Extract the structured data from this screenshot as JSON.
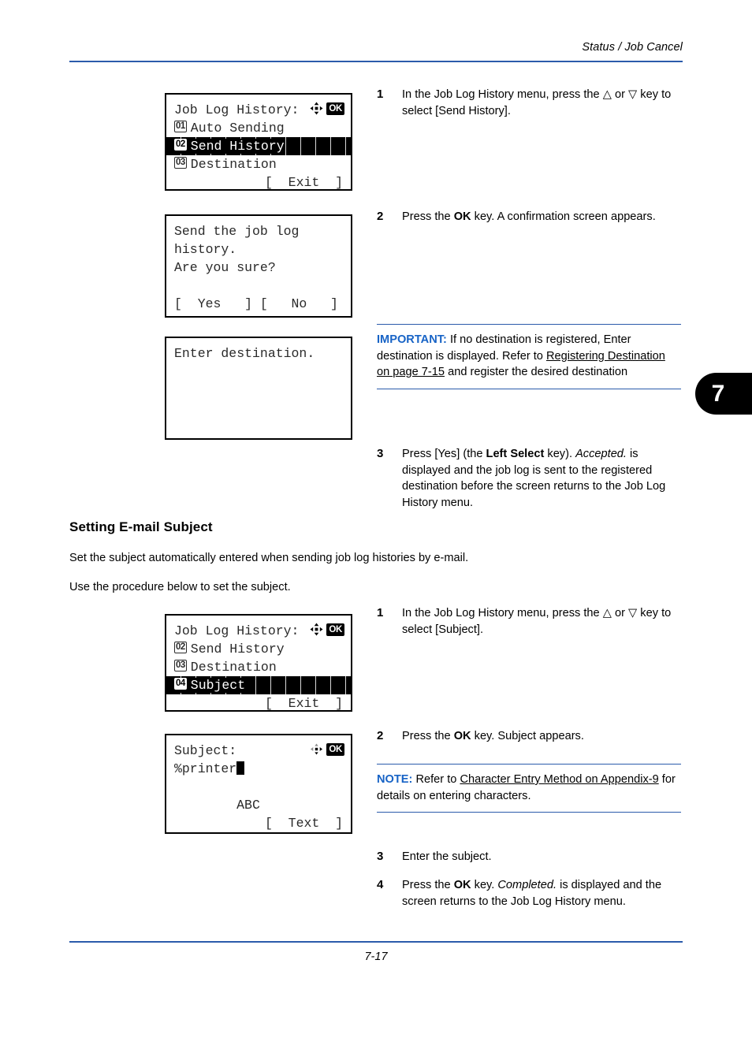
{
  "header": {
    "running_head": "Status / Job Cancel",
    "rule_color": "#2b5bab"
  },
  "chapter_tab": {
    "number": "7"
  },
  "footer": {
    "page_number": "7-17"
  },
  "lcd_panels": [
    {
      "name": "job-log-history-send-history",
      "title": "Job Log History:",
      "indicator_ok": "OK",
      "indicator_arrows": "four-way-arrow",
      "rows": [
        {
          "num": "01",
          "label": "Auto Sending",
          "selected": false
        },
        {
          "num": "02",
          "label": "Send History",
          "selected": true
        },
        {
          "num": "03",
          "label": "Destination",
          "selected": false
        }
      ],
      "softkey": "[  Exit  ]"
    },
    {
      "name": "confirm-send-job-log",
      "lines": [
        "Send the job log",
        "history.",
        "Are you sure?"
      ],
      "softkeys": "[  Yes   ] [   No   ]"
    },
    {
      "name": "enter-destination",
      "lines": [
        "Enter destination."
      ]
    },
    {
      "name": "job-log-history-subject",
      "title": "Job Log History:",
      "indicator_ok": "OK",
      "indicator_arrows": "four-way-arrow",
      "rows": [
        {
          "num": "02",
          "label": "Send History",
          "selected": false
        },
        {
          "num": "03",
          "label": "Destination",
          "selected": false
        },
        {
          "num": "04",
          "label": "Subject",
          "selected": true
        }
      ],
      "softkey": "[  Exit  ]"
    },
    {
      "name": "subject-entry",
      "title": "Subject:",
      "indicator_ok": "OK",
      "indicator_arrows": "left-right-arrow",
      "value": "%printer",
      "input_mode": "ABC",
      "softkey": "[  Text  ]"
    }
  ],
  "steps_send_history": [
    {
      "num": "1",
      "parts": [
        {
          "t": "In the Job Log History menu, press the "
        },
        {
          "t": "△",
          "style": "plain"
        },
        {
          "t": " or "
        },
        {
          "t": "▽",
          "style": "plain"
        },
        {
          "t": " key to select [Send History]."
        }
      ],
      "plain": "In the Job Log History menu, press the △ or ▽ key to select [Send History]."
    },
    {
      "num": "2",
      "plain": "Press the OK key. A confirmation screen appears."
    },
    {
      "num": "3",
      "plain": "Press [Yes] (the Left Select key). Accepted. is displayed and the job log is sent to the registered destination before the screen returns to the Job Log History menu."
    }
  ],
  "important_note": {
    "label": "IMPORTANT:",
    "text_before": " If no destination is registered, Enter destination is displayed. Refer to ",
    "xref": "Registering Destination on page 7-15",
    "text_after": " and register the desired destination"
  },
  "section": {
    "title": "Setting E-mail Subject",
    "paragraph_1": "Set the subject automatically entered when sending job log histories by e-mail.",
    "paragraph_2": "Use the procedure below to set the subject."
  },
  "steps_subject": [
    {
      "num": "1",
      "plain": "In the Job Log History menu, press the △ or ▽ key to select [Subject]."
    },
    {
      "num": "2",
      "plain": "Press the OK key. Subject appears."
    },
    {
      "num": "3",
      "plain": "Enter the subject."
    },
    {
      "num": "4",
      "plain": "Press the OK key. Completed. is displayed and the screen returns to the Job Log History menu."
    }
  ],
  "note": {
    "label": "NOTE:",
    "text_before": " Refer to ",
    "xref": "Character Entry Method on Appendix-9",
    "text_after": " for details on entering characters."
  }
}
